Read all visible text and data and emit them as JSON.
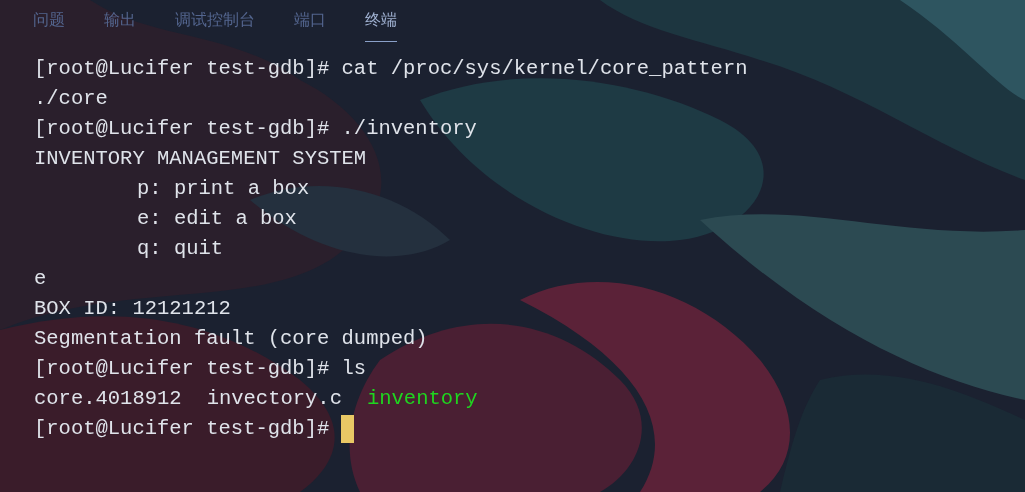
{
  "tabs": [
    {
      "label": "问题",
      "selected": false
    },
    {
      "label": "输出",
      "selected": false
    },
    {
      "label": "调试控制台",
      "selected": false
    },
    {
      "label": "端口",
      "selected": false
    },
    {
      "label": "终端",
      "selected": true
    }
  ],
  "terminal": {
    "lines": [
      {
        "kind": "plain",
        "text": "[root@Lucifer test-gdb]# cat /proc/sys/kernel/core_pattern"
      },
      {
        "kind": "plain",
        "text": "./core"
      },
      {
        "kind": "plain",
        "text": "[root@Lucifer test-gdb]# ./inventory"
      },
      {
        "kind": "plain",
        "text": "INVENTORY MANAGEMENT SYSTEM"
      },
      {
        "kind": "indented",
        "text": "p: print a box"
      },
      {
        "kind": "indented",
        "text": "e: edit a box"
      },
      {
        "kind": "indented",
        "text": "q: quit"
      },
      {
        "kind": "plain",
        "text": "e"
      },
      {
        "kind": "plain",
        "text": "BOX ID: 12121212"
      },
      {
        "kind": "plain",
        "text": "Segmentation fault (core dumped)"
      },
      {
        "kind": "plain",
        "text": "[root@Lucifer test-gdb]# ls"
      },
      {
        "kind": "listing",
        "entries": [
          {
            "text": "core.4018912",
            "kind": "file"
          },
          {
            "text": "invectory.c",
            "kind": "file"
          },
          {
            "text": "inventory",
            "kind": "executable"
          }
        ]
      },
      {
        "kind": "prompt",
        "text": "[root@Lucifer test-gdb]#",
        "cursor": true
      }
    ]
  }
}
